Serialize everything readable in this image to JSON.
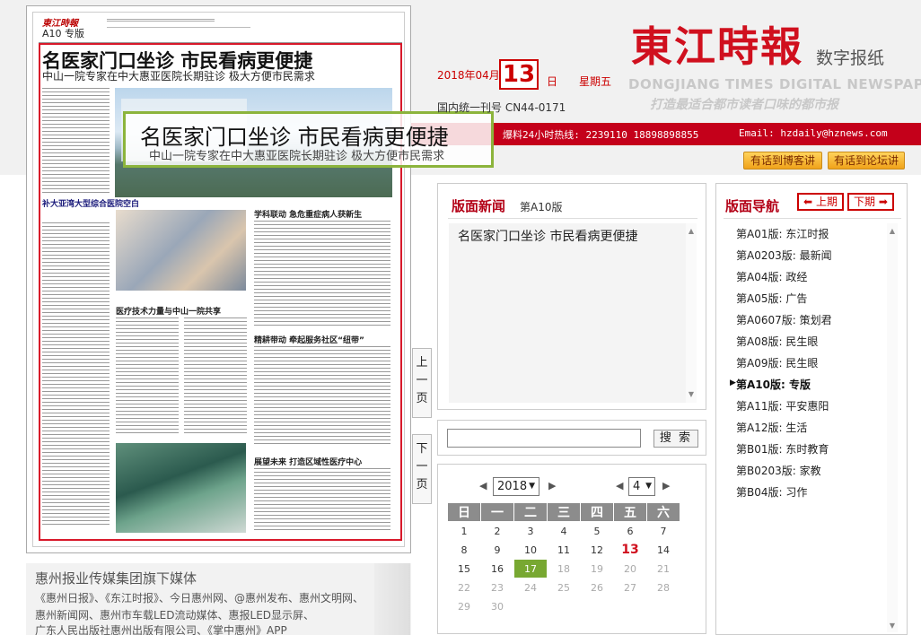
{
  "header": {
    "year_month": "2018年04月",
    "day": "13",
    "day_suffix": "日",
    "weekday": "星期五",
    "cn_number": "国内统一刊号 CN44-0171",
    "logo_text": "東江時報",
    "logo_sub": "数字报纸",
    "logo_en": "DONGJIANG TIMES DIGITAL NEWSPAPER",
    "slogan": "打造最适合都市读者口味的都市报",
    "hotline": "爆料24小时热线: 2239110 18898898855",
    "email": "Email: hzdaily@hznews.com",
    "btn_guestbook": "有话到博客讲",
    "btn_forum": "有话到论坛讲"
  },
  "paper": {
    "masthead": "東江時報",
    "edition": "A10 专版",
    "headline": "名医家门口坐诊 市民看病更便捷",
    "subhead": "中山一院专家在中大惠亚医院长期驻诊 极大方便市民需求",
    "section1": "学科联动 急危重症病人获新生",
    "section2": "医疗技术力量与中山一院共享",
    "section3": "精耕带动 牵起服务社区“纽带”",
    "section4": "展望未来 打造区域性医疗中心",
    "leftcol_head": "补大亚湾大型综合医院空白"
  },
  "overlay": {
    "title": "名医家门口坐诊 市民看病更便捷",
    "subtitle": "中山一院专家在中大惠亚医院长期驻诊 极大方便市民需求"
  },
  "side_buttons": {
    "prev_page": "上一页",
    "next_page": "下一页"
  },
  "news_panel": {
    "title": "版面新闻",
    "edition": "第A10版",
    "items": [
      "名医家门口坐诊 市民看病更便捷"
    ]
  },
  "search": {
    "value": "",
    "button": "搜 索"
  },
  "calendar": {
    "year": "2018",
    "month": "4",
    "weekdays": [
      "日",
      "一",
      "二",
      "三",
      "四",
      "五",
      "六"
    ],
    "weeks": [
      [
        "1",
        "2",
        "3",
        "4",
        "5",
        "6",
        "7"
      ],
      [
        "8",
        "9",
        "10",
        "11",
        "12",
        "13",
        "14"
      ],
      [
        "15",
        "16",
        "17",
        "18",
        "19",
        "20",
        "21"
      ],
      [
        "22",
        "23",
        "24",
        "25",
        "26",
        "27",
        "28"
      ],
      [
        "29",
        "30",
        "",
        "",
        "",
        "",
        ""
      ]
    ],
    "today": "13",
    "selected": "17",
    "accent_color": "#78a832"
  },
  "nav_panel": {
    "title": "版面导航",
    "prev": "上期",
    "next": "下期",
    "current": "第A10版: 专版",
    "items": [
      "第A01版: 东江时报",
      "第A0203版: 最新闻",
      "第A04版: 政经",
      "第A05版: 广告",
      "第A0607版: 策划君",
      "第A08版: 民生眼",
      "第A09版: 民生眼",
      "第A10版: 专版",
      "第A11版: 平安惠阳",
      "第A12版: 生活",
      "第B01版: 东时教育",
      "第B0203版: 家教",
      "第B04版: 习作"
    ]
  },
  "media": {
    "title": "惠州报业传媒集团旗下媒体",
    "line1": "《惠州日报》、《东江时报》、今日惠州网、@惠州发布、惠州文明网、",
    "line2": "惠州新闻网、惠州市车载LED流动媒体、惠报LED显示屏、",
    "line3": "广东人民出版社惠州出版有限公司、《掌中惠州》APP"
  },
  "colors": {
    "brand_red": "#c4001a",
    "panel_title": "#b30016",
    "overlay_border": "#8cb43c"
  }
}
